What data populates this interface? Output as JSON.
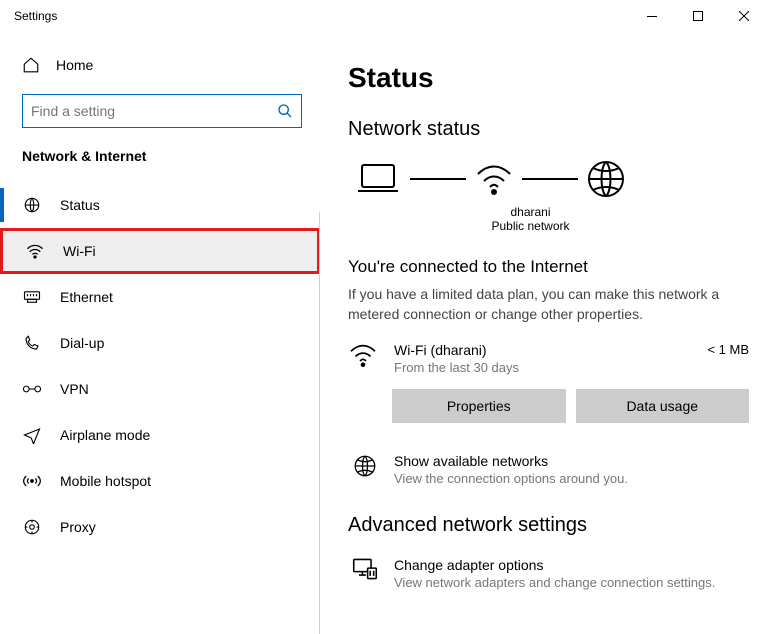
{
  "window": {
    "title": "Settings"
  },
  "sidebar": {
    "home": "Home",
    "search_placeholder": "Find a setting",
    "section": "Network & Internet",
    "items": [
      {
        "label": "Status"
      },
      {
        "label": "Wi-Fi"
      },
      {
        "label": "Ethernet"
      },
      {
        "label": "Dial-up"
      },
      {
        "label": "VPN"
      },
      {
        "label": "Airplane mode"
      },
      {
        "label": "Mobile hotspot"
      },
      {
        "label": "Proxy"
      }
    ]
  },
  "content": {
    "page_title": "Status",
    "network_status_heading": "Network status",
    "diagram": {
      "ssid": "dharani",
      "network_type": "Public network"
    },
    "connected_title": "You're connected to the Internet",
    "connected_desc": "If you have a limited data plan, you can make this network a metered connection or change other properties.",
    "connection": {
      "name": "Wi-Fi (dharani)",
      "subtitle": "From the last 30 days",
      "usage": "< 1 MB"
    },
    "buttons": {
      "properties": "Properties",
      "data_usage": "Data usage"
    },
    "show_networks": {
      "title": "Show available networks",
      "subtitle": "View the connection options around you."
    },
    "advanced_heading": "Advanced network settings",
    "adapter": {
      "title": "Change adapter options",
      "subtitle": "View network adapters and change connection settings."
    }
  }
}
